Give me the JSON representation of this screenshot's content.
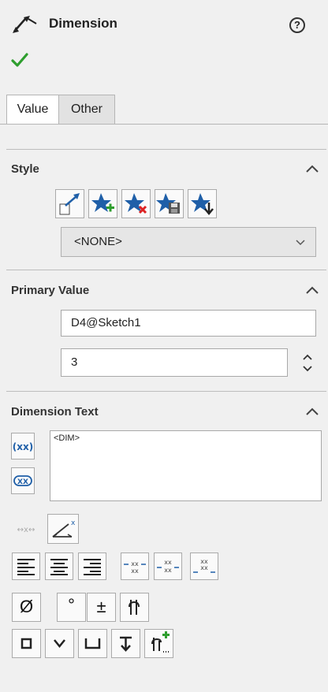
{
  "header": {
    "title": "Dimension",
    "help_symbol": "?"
  },
  "tabs": [
    {
      "label": "Value",
      "active": true
    },
    {
      "label": "Other",
      "active": false
    }
  ],
  "style_section": {
    "title": "Style",
    "buttons": [
      "apply-default-icon",
      "add-style-icon",
      "delete-style-icon",
      "save-style-icon",
      "load-style-icon"
    ],
    "selected": "<NONE>"
  },
  "primary_value": {
    "title": "Primary Value",
    "name": "D4@Sketch1",
    "value": "3"
  },
  "dimension_text": {
    "title": "Dimension Text",
    "text": "<DIM>",
    "symbols": {
      "diameter": "Ø",
      "degree": "°",
      "plus_minus": "±"
    }
  },
  "colors": {
    "accent_green": "#2e9e2e",
    "panel_bg": "#f0f0f0",
    "icon_blue": "#1f5fa8"
  }
}
